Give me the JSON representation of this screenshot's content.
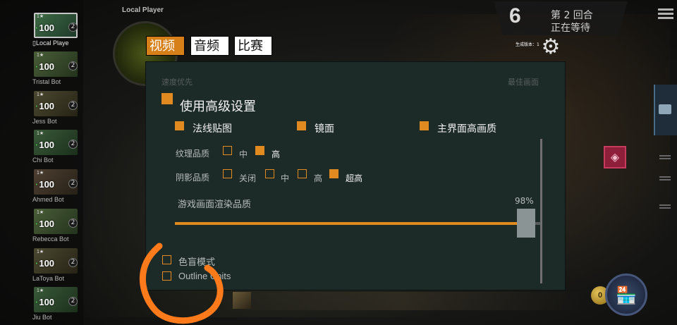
{
  "header": {
    "local_player_label": "Local Player"
  },
  "round_info": {
    "number": "6",
    "line1": "第 2 回合",
    "line2": "正在等待",
    "build_version": "生成版本：1"
  },
  "players": [
    {
      "name": "Local Playe",
      "hp": "100",
      "level": "2",
      "star": "1★",
      "you": true
    },
    {
      "name": "Tristal Bot",
      "hp": "100",
      "level": "2",
      "star": "1★"
    },
    {
      "name": "Jess Bot",
      "hp": "100",
      "level": "2",
      "star": "1★"
    },
    {
      "name": "Chi Bot",
      "hp": "100",
      "level": "2",
      "star": "1★"
    },
    {
      "name": "Ahmed Bot",
      "hp": "100",
      "level": "2",
      "star": "1★"
    },
    {
      "name": "Rebecca Bot",
      "hp": "100",
      "level": "2",
      "star": "1★"
    },
    {
      "name": "LaToya Bot",
      "hp": "100",
      "level": "2",
      "star": "1★"
    },
    {
      "name": "Jiu Bot",
      "hp": "100",
      "level": "2",
      "star": "1★"
    }
  ],
  "tabs": [
    {
      "label": "视频",
      "active": true
    },
    {
      "label": "音频",
      "active": false
    },
    {
      "label": "比赛",
      "active": false
    }
  ],
  "settings": {
    "speed_priority_label": "速度优先",
    "best_quality_label": "最佳画面",
    "advanced_label": "使用高级设置",
    "advanced_checked": true,
    "feature_toggles": [
      {
        "label": "法线贴图",
        "checked": true
      },
      {
        "label": "镜面",
        "checked": true
      },
      {
        "label": "主界面高画质",
        "checked": true
      }
    ],
    "texture_quality": {
      "label": "纹理品质",
      "options": [
        {
          "label": "中",
          "checked": false
        },
        {
          "label": "高",
          "checked": true
        }
      ]
    },
    "shadow_quality": {
      "label": "阴影品质",
      "options": [
        {
          "label": "关闭",
          "checked": false
        },
        {
          "label": "中",
          "checked": false
        },
        {
          "label": "高",
          "checked": false
        },
        {
          "label": "超高",
          "checked": true
        }
      ]
    },
    "render_quality": {
      "label": "游戏画面渲染品质",
      "value_text": "98%",
      "value": 0.98
    },
    "colorblind_mode": {
      "label": "色盲模式",
      "checked": false
    },
    "outline_units": {
      "label": "Outline Units",
      "checked": false
    }
  },
  "hud": {
    "gold": "0"
  },
  "colors": {
    "accent": "#e08a20",
    "panel": "#1c2a28",
    "annotation": "#ff7a1a"
  },
  "icons": {
    "settings": "gear-icon",
    "menu": "hamburger-icon",
    "shop": "shop-icon"
  }
}
